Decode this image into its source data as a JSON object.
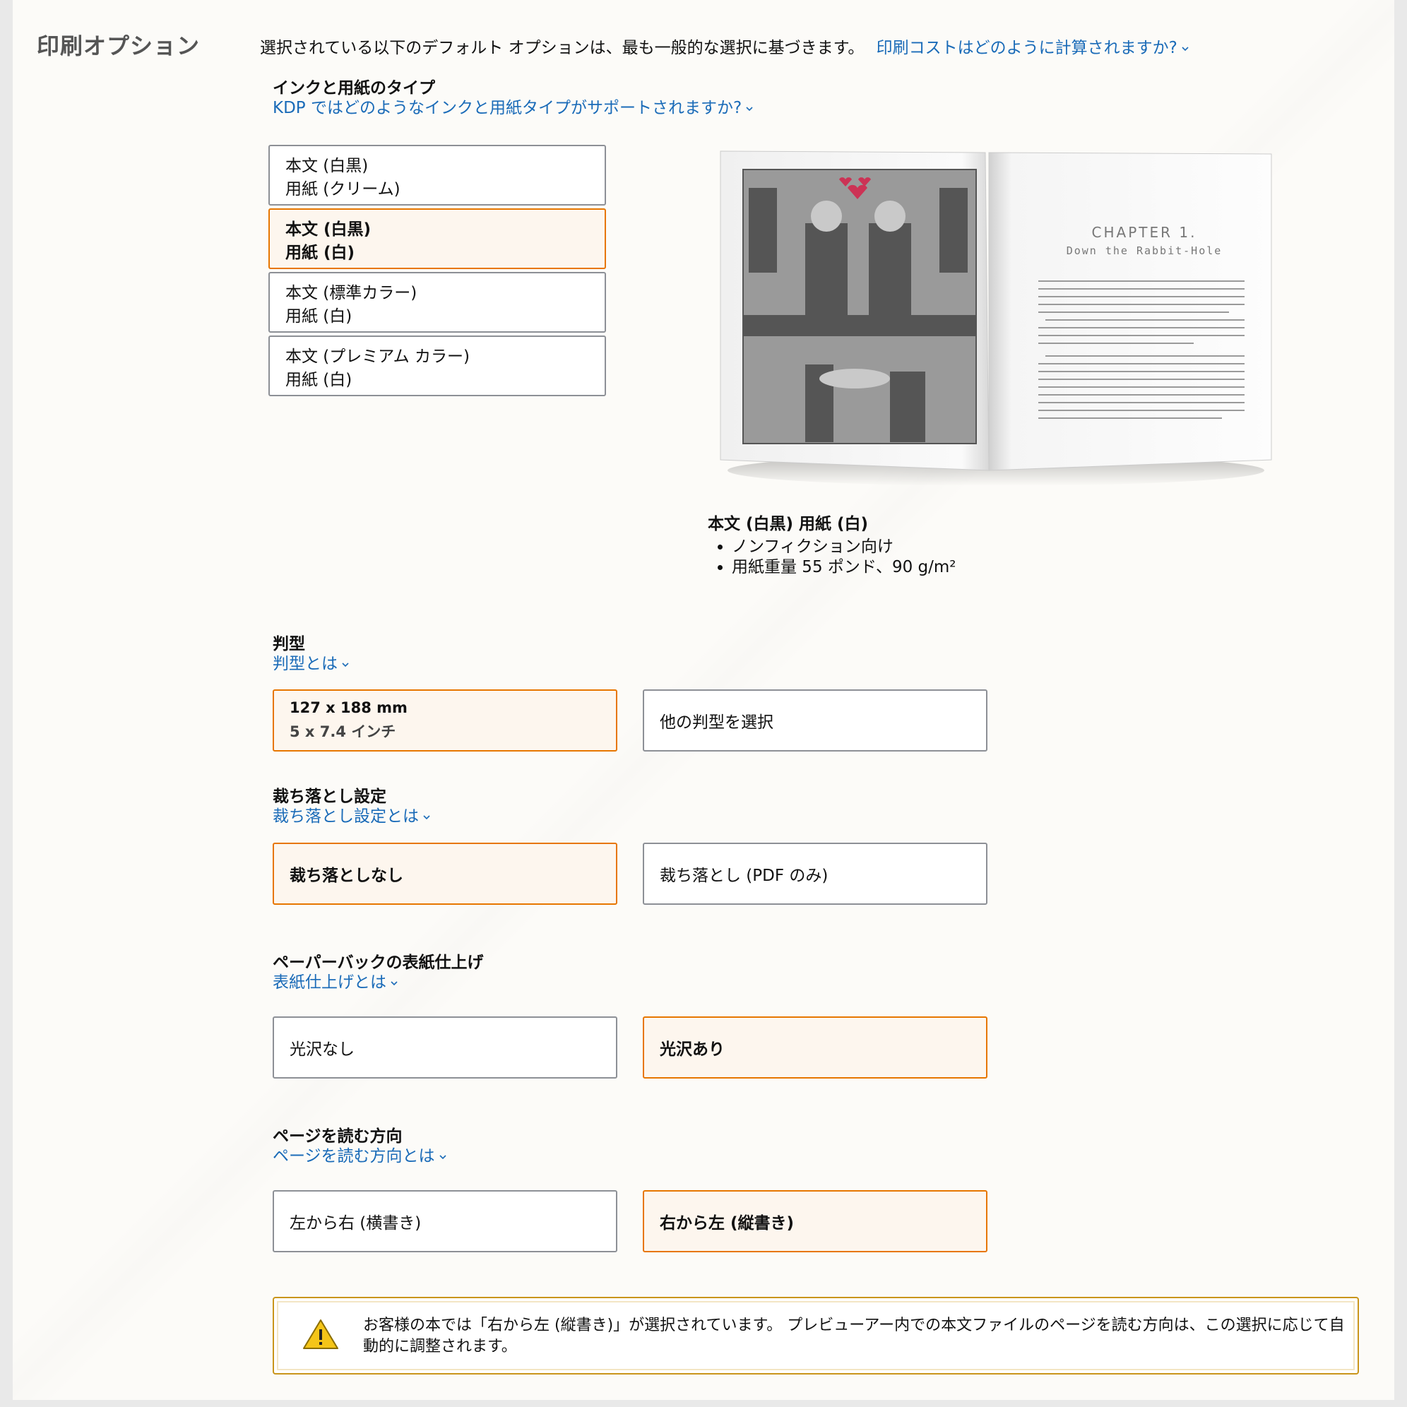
{
  "section": {
    "title": "印刷オプション",
    "intro_text": "選択されている以下のデフォルト オプションは、最も一般的な選択に基づきます。",
    "intro_link": "印刷コストはどのように計算されますか?"
  },
  "ink_paper": {
    "heading": "インクと用紙のタイプ",
    "help_link": "KDP ではどのようなインクと用紙タイプがサポートされますか?",
    "options": [
      {
        "line1": "本文 (白黒)",
        "line2": "用紙 (クリーム)",
        "selected": false
      },
      {
        "line1": "本文 (白黒)",
        "line2": "用紙 (白)",
        "selected": true
      },
      {
        "line1": "本文 (標準カラー)",
        "line2": "用紙 (白)",
        "selected": false
      },
      {
        "line1": "本文 (プレミアム カラー)",
        "line2": "用紙 (白)",
        "selected": false
      }
    ],
    "preview": {
      "chapter_title": "CHAPTER 1.",
      "chapter_subtitle": "Down the Rabbit-Hole",
      "caption_title": "本文 (白黒) 用紙 (白)",
      "bullets": [
        "ノンフィクション向け",
        "用紙重量 55 ポンド、90 g/m²"
      ]
    }
  },
  "trim_size": {
    "heading": "判型",
    "help_link": "判型とは",
    "selected_option": {
      "line1": "127 x 188 mm",
      "line2": "5 x 7.4 インチ"
    },
    "other_option": "他の判型を選択"
  },
  "bleed": {
    "heading": "裁ち落とし設定",
    "help_link": "裁ち落とし設定とは",
    "options": [
      "裁ち落としなし",
      "裁ち落とし (PDF のみ)"
    ],
    "selected_index": 0
  },
  "cover_finish": {
    "heading": "ペーパーバックの表紙仕上げ",
    "help_link": "表紙仕上げとは",
    "options": [
      "光沢なし",
      "光沢あり"
    ],
    "selected_index": 1
  },
  "reading_direction": {
    "heading": "ページを読む方向",
    "help_link": "ページを読む方向とは",
    "options": [
      "左から右 (横書き)",
      "右から左 (縦書き)"
    ],
    "selected_index": 1
  },
  "alert": {
    "icon": "warning-icon",
    "text": "お客様の本では「右から左 (縦書き)」が選択されています。 プレビューアー内での本文ファイルのページを読む方向は、この選択に応じて自動的に調整されます。"
  },
  "colors": {
    "selected_border": "#e77600",
    "selected_fill": "#fdf6ee",
    "link": "#1a6bb8",
    "alert_border": "#c9951b",
    "warning_yellow": "#f5c518"
  }
}
